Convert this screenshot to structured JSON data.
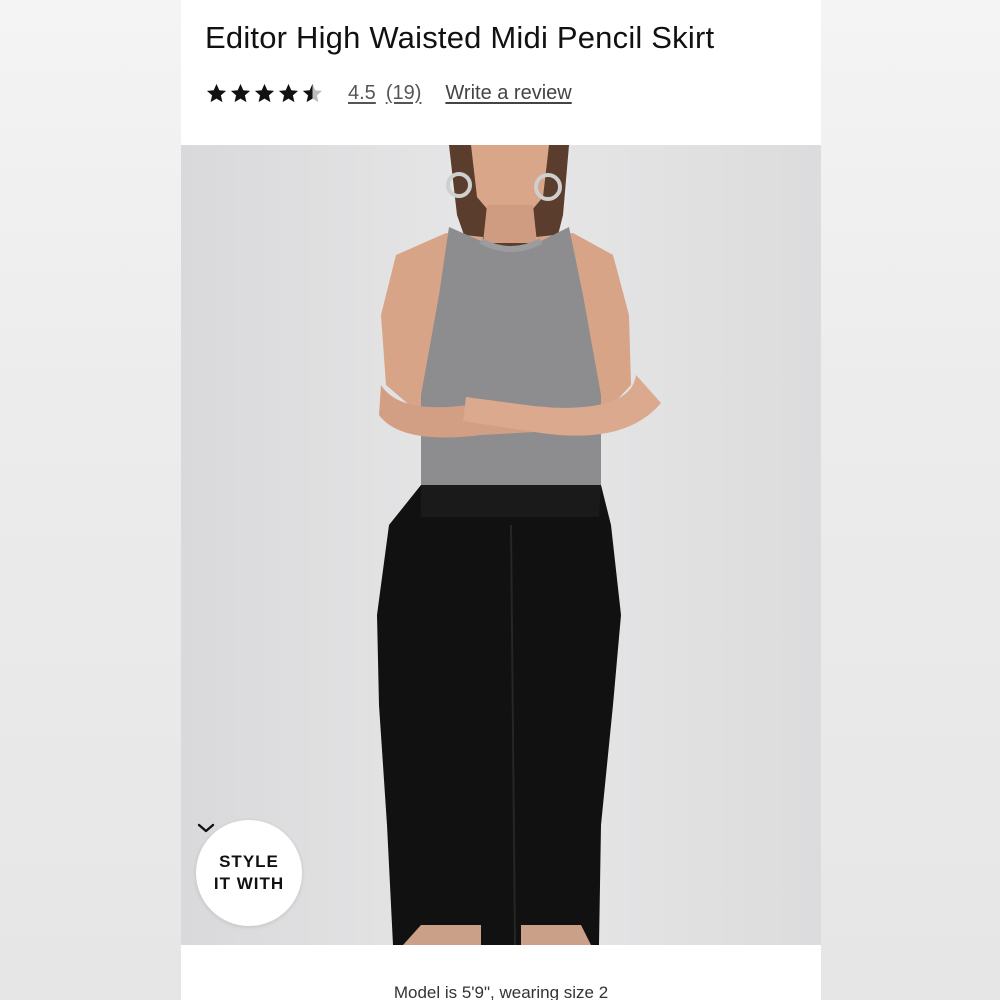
{
  "product": {
    "title": "Editor High Waisted Midi Pencil Skirt",
    "rating_value": "4.5",
    "rating_stars": 4.5,
    "rating_max": 5,
    "review_count": "(19)",
    "write_review_label": "Write a review"
  },
  "style_button": {
    "line1": "STYLE",
    "line2": "IT WITH",
    "icon": "chevron-down-icon"
  },
  "model_info": "Model is 5'9\", wearing size 2",
  "colors": {
    "text": "#111111",
    "link": "#555555",
    "skirt": "#111111",
    "top": "#8d8d8f"
  }
}
